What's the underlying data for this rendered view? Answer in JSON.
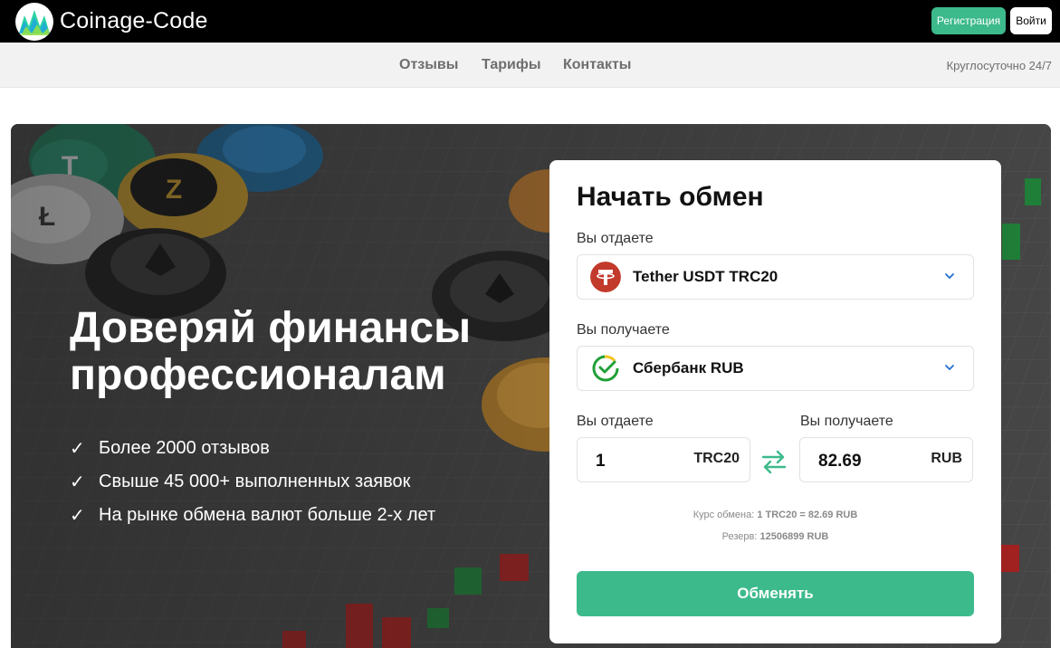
{
  "header": {
    "brand": "Coinage-Code",
    "register_label": "Регистрация",
    "login_label": "Войти"
  },
  "nav": {
    "items": [
      "Отзывы",
      "Тарифы",
      "Контакты"
    ],
    "support": "Круглосуточно 24/7"
  },
  "hero": {
    "title": "Доверяй финансы профессионалам",
    "bullets": [
      "Более 2000 отзывов",
      "Свыше 45 000+ выполненных заявок",
      "На рынке обмена валют больше 2-х лет"
    ],
    "check": "✓"
  },
  "exchange": {
    "title": "Начать обмен",
    "give_label": "Вы отдаете",
    "give_currency": "Tether USDT TRC20",
    "get_label": "Вы получаете",
    "get_currency": "Сбербанк RUB",
    "amount_give_label": "Вы отдаете",
    "amount_give_value": "1",
    "amount_give_unit": "TRC20",
    "amount_get_label": "Вы получаете",
    "amount_get_value": "82.69",
    "amount_get_unit": "RUB",
    "rate_label": "Курс обмена:",
    "rate_value": "1 TRC20 = 82.69 RUB",
    "reserve_label": "Резерв:",
    "reserve_value": "12506899 RUB",
    "submit_label": "Обменять"
  },
  "colors": {
    "accent": "#3dba8c",
    "tether": "#c23a2b",
    "sber": "#21a038"
  },
  "icons": [
    "logo-icon",
    "tether-icon",
    "sberbank-icon",
    "chevron-down-icon",
    "swap-icon",
    "check-icon"
  ]
}
